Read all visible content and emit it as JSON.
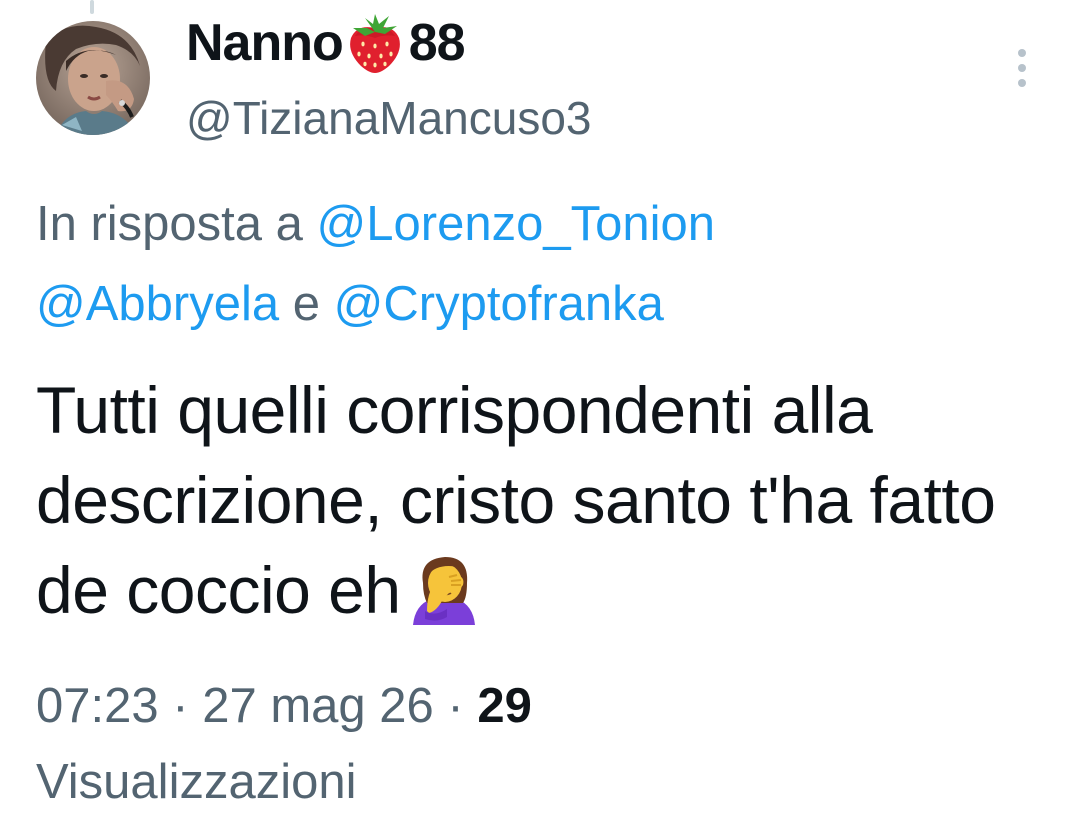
{
  "author": {
    "name_before_emoji": "Nanno",
    "name_emoji_icon": "strawberry-icon",
    "name_after_emoji": "88",
    "handle": "@TizianaMancuso3"
  },
  "reply_context": {
    "prefix": "In risposta a",
    "mentions": [
      "@Lorenzo_Tonion",
      "@Abbryela",
      "@Cryptofranka"
    ],
    "conjunction": "e"
  },
  "tweet": {
    "text": "Tutti quelli corrispondenti alla descrizione, cristo santo t'ha fatto de coccio eh",
    "trailing_emoji_icon": "woman-facepalming-icon"
  },
  "meta": {
    "time": "07:23",
    "separator": "·",
    "date": "27 mag 26",
    "views_count": "29",
    "views_label": "Visualizzazioni"
  },
  "colors": {
    "text_primary": "#0f1419",
    "text_secondary": "#536471",
    "link": "#1d9bf0",
    "more_icon": "#b7c2cb"
  }
}
